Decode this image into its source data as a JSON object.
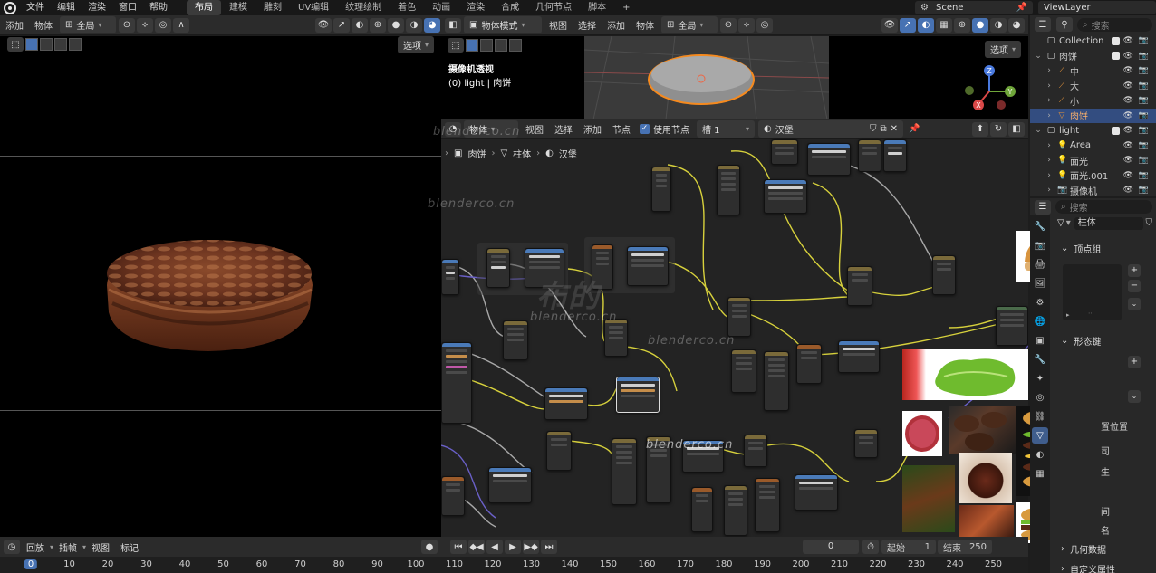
{
  "menubar": {
    "items": [
      "文件",
      "编辑",
      "渲染",
      "窗口",
      "帮助"
    ],
    "workspaces": [
      "布局",
      "建模",
      "雕刻",
      "UV编辑",
      "纹理绘制",
      "着色",
      "动画",
      "渲染",
      "合成",
      "几何节点",
      "脚本"
    ],
    "active_workspace": "布局",
    "add_workspace": "+",
    "scene": "Scene",
    "view_layer": "ViewLayer"
  },
  "left_viewport": {
    "header": {
      "add": "添加",
      "object": "物体",
      "transform": "全局",
      "options": "选项"
    }
  },
  "right_viewport": {
    "header": {
      "mode": "物体模式",
      "view": "视图",
      "select": "选择",
      "add": "添加",
      "object": "物体",
      "transform": "全局",
      "options": "选项"
    },
    "camera_title": "摄像机透视",
    "camera_sub": "(0) light | 肉饼"
  },
  "node_editor": {
    "header": {
      "object": "物体",
      "view": "视图",
      "select": "选择",
      "add": "添加",
      "node": "节点",
      "use_nodes": "使用节点",
      "slot": "槽 1",
      "material": "汉堡"
    },
    "breadcrumb": [
      "肉饼",
      "柱体",
      "汉堡"
    ]
  },
  "outliner": {
    "search_placeholder": "搜索",
    "rows": [
      {
        "label": "Collection",
        "depth": 0,
        "icon": "collection-icon",
        "checkbox": true
      },
      {
        "label": "肉饼",
        "depth": 0,
        "icon": "collection-icon",
        "checkbox": true
      },
      {
        "label": "中",
        "depth": 1,
        "icon": "bone-icon"
      },
      {
        "label": "大",
        "depth": 1,
        "icon": "bone-icon"
      },
      {
        "label": "小",
        "depth": 1,
        "icon": "bone-icon"
      },
      {
        "label": "肉饼",
        "depth": 1,
        "icon": "mesh-icon",
        "selected": true
      },
      {
        "label": "light",
        "depth": 0,
        "icon": "collection-icon",
        "checkbox": true
      },
      {
        "label": "Area",
        "depth": 1,
        "icon": "light-icon"
      },
      {
        "label": "面光",
        "depth": 1,
        "icon": "light-icon"
      },
      {
        "label": "面光.001",
        "depth": 1,
        "icon": "light-icon"
      },
      {
        "label": "摄像机",
        "depth": 1,
        "icon": "camera-icon"
      }
    ]
  },
  "properties": {
    "search_placeholder": "搜索",
    "object_name": "柱体",
    "sections": {
      "vertex_groups": "顶点组",
      "shape_keys": "形态键",
      "geometry_data": "几何数据",
      "custom_props": "自定义属性"
    },
    "partial_labels": [
      "置位置",
      "司",
      "生",
      "间",
      "名"
    ]
  },
  "timeline": {
    "playback": "回放",
    "keying": "插帧",
    "view": "视图",
    "marker": "标记",
    "current_frame": "0",
    "start_label": "起始",
    "start": "1",
    "end_label": "结束",
    "end": "250",
    "ruler": [
      "0",
      "10",
      "20",
      "30",
      "40",
      "50",
      "60",
      "70",
      "80",
      "90",
      "100",
      "110",
      "120",
      "130",
      "140",
      "150",
      "160",
      "170",
      "180",
      "190",
      "200",
      "210",
      "220",
      "230",
      "240",
      "250"
    ]
  },
  "watermark": {
    "text": "blenderco.cn",
    "big": "布的"
  },
  "colors": {
    "accent": "#4772b3",
    "selected_row": "#334d80",
    "orange_outline": "#f58a1f",
    "node_yellow_link": "#d7d13c",
    "node_gray_link": "#a8a8a8",
    "node_purple_link": "#6a60c8"
  }
}
